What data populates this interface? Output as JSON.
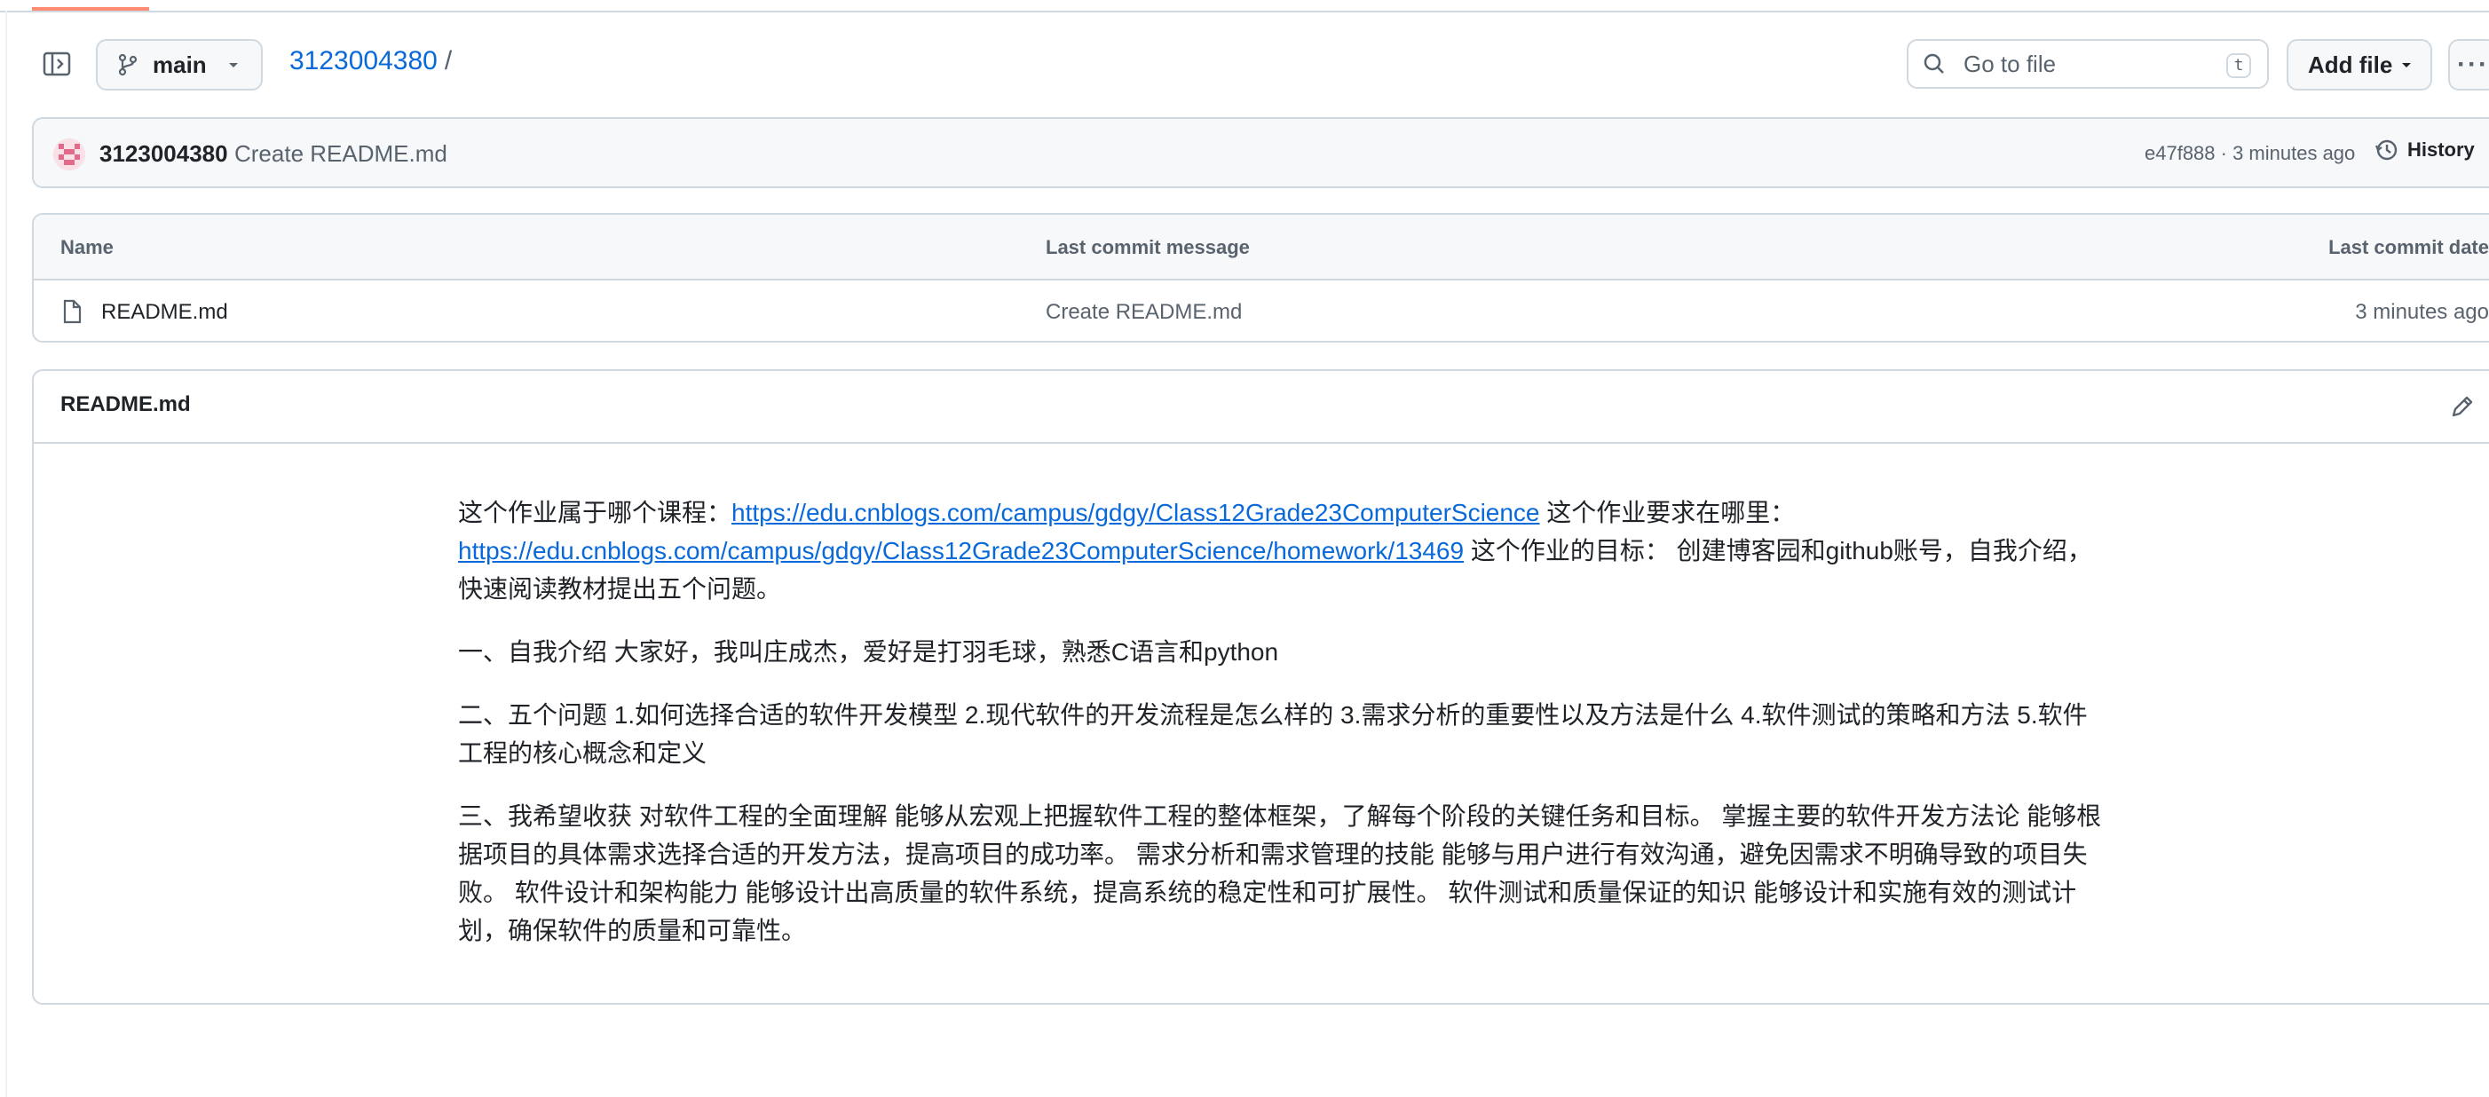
{
  "toolbar": {
    "branch": "main",
    "repo_link": "3123004380",
    "separator": "/",
    "search_placeholder": "Go to file",
    "search_shortcut": "t",
    "add_file_label": "Add file",
    "more_label": "···"
  },
  "commit": {
    "author": "3123004380",
    "message": "Create README.md",
    "meta": "e47f888 · 3 minutes ago",
    "history_label": "History"
  },
  "files": {
    "headers": {
      "name": "Name",
      "message": "Last commit message",
      "date": "Last commit date"
    },
    "rows": [
      {
        "name": "README.md",
        "message": "Create README.md",
        "date": "3 minutes ago"
      }
    ]
  },
  "readme": {
    "title": "README.md",
    "p1_text1": "这个作业属于哪个课程：",
    "p1_link1": "https://edu.cnblogs.com/campus/gdgy/Class12Grade23ComputerScience",
    "p1_text2": " 这个作业要求在哪里：",
    "p1_link2": "https://edu.cnblogs.com/campus/gdgy/Class12Grade23ComputerScience/homework/13469",
    "p1_text3": " 这个作业的目标： 创建博客园和github账号，自我介绍，快速阅读教材提出五个问题。",
    "p2": "一、自我介绍 大家好，我叫庄成杰，爱好是打羽毛球，熟悉C语言和python",
    "p3": "二、五个问题 1.如何选择合适的软件开发模型 2.现代软件的开发流程是怎么样的 3.需求分析的重要性以及方法是什么 4.软件测试的策略和方法 5.软件工程的核心概念和定义",
    "p4": "三、我希望收获 对软件工程的全面理解 能够从宏观上把握软件工程的整体框架，了解每个阶段的关键任务和目标。 掌握主要的软件开发方法论 能够根据项目的具体需求选择合适的开发方法，提高项目的成功率。 需求分析和需求管理的技能 能够与用户进行有效沟通，避免因需求不明确导致的项目失败。 软件设计和架构能力 能够设计出高质量的软件系统，提高系统的稳定性和可扩展性。 软件测试和质量保证的知识 能够设计和实施有效的测试计划，确保软件的质量和可靠性。"
  },
  "colors": {
    "link": "#0969da",
    "border": "#d1d9e0",
    "muted": "#59636e",
    "tab_accent": "#fd8c73"
  }
}
